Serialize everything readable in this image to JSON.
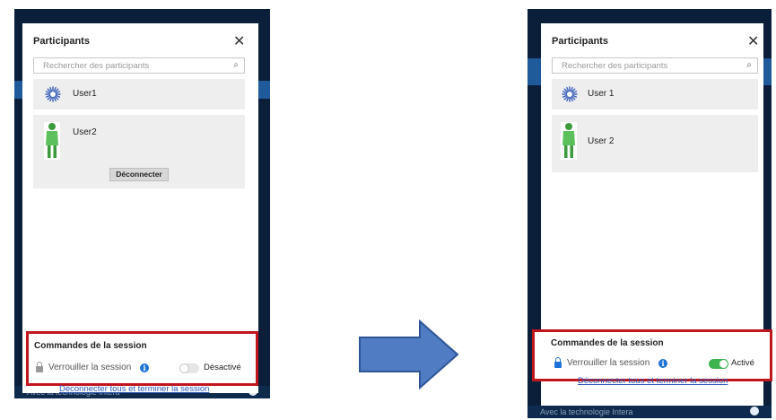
{
  "before": {
    "panel_title": "Participants",
    "close_glyph": "✕",
    "search_placeholder": "Rechercher des participants",
    "users": [
      {
        "name": "User1"
      },
      {
        "name": "User2",
        "action": "Déconnecter"
      }
    ],
    "session": {
      "title": "Commandes de la session",
      "lock_label": "Verrouiller la session",
      "toggle_state": "Désactivé",
      "toggle_on": false
    },
    "disconnect_all": "Déconnecter tous et terminer la session",
    "footer": "Avec la technologie Intera"
  },
  "after": {
    "panel_title": "Participants",
    "close_glyph": "✕",
    "search_placeholder": "Rechercher des participants",
    "users": [
      {
        "name": "User 1"
      },
      {
        "name": "User 2"
      }
    ],
    "session": {
      "title": "Commandes de la session",
      "lock_label": "Verrouiller la session",
      "toggle_state": "Activé",
      "toggle_on": true
    },
    "disconnect_all": "Déconnecter tous et terminer la session",
    "footer": "Avec la technologie Intera"
  },
  "colors": {
    "highlight_border": "#c0161c",
    "toggle_on": "#3fb34f",
    "info_blue": "#1e73d8",
    "arrow_fill": "#4f7cc2",
    "arrow_stroke": "#2f5597",
    "link_blue": "#2b58b8"
  }
}
